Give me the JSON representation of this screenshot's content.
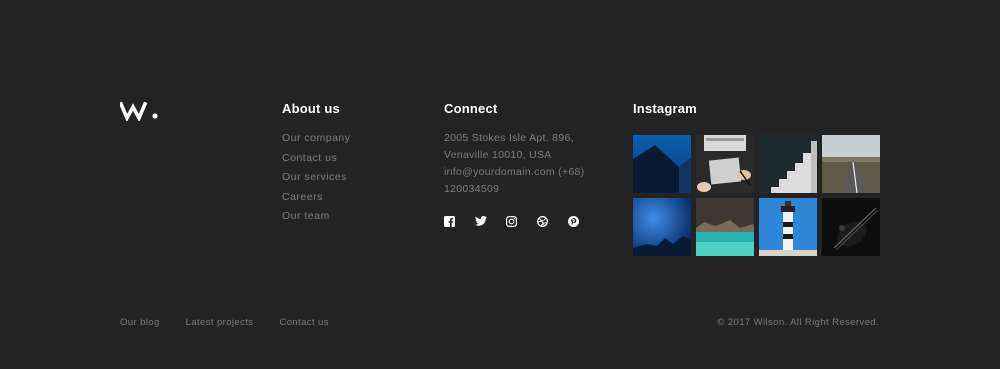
{
  "brand": {
    "logo_icon": "w-dot-logo"
  },
  "about": {
    "title": "About us",
    "links": [
      "Our company",
      "Contact us",
      "Our services",
      "Careers",
      "Our team"
    ]
  },
  "connect": {
    "title": "Connect",
    "address_line1": "2005 Stokes Isle Apt. 896,",
    "address_line2": "Venaville 10010, USA",
    "email": "info@yourdomain.com (+68)",
    "phone": "120034509",
    "social_icons": [
      "facebook-icon",
      "twitter-icon",
      "instagram-icon",
      "dribbble-icon",
      "pinterest-icon"
    ]
  },
  "instagram": {
    "title": "Instagram",
    "photos": [
      "blue-building",
      "laptop-hands",
      "white-stairs",
      "road-landscape",
      "blue-night-sky",
      "sea-cliff",
      "lighthouse",
      "dark-guitar"
    ]
  },
  "bottom": {
    "links": [
      "Our blog",
      "Latest projects",
      "Contact us"
    ],
    "copyright": "© 2017 Wilson. All Right Reserved."
  },
  "colors": {
    "background": "#232323",
    "heading": "#ffffff",
    "muted": "#7d7d7d"
  }
}
